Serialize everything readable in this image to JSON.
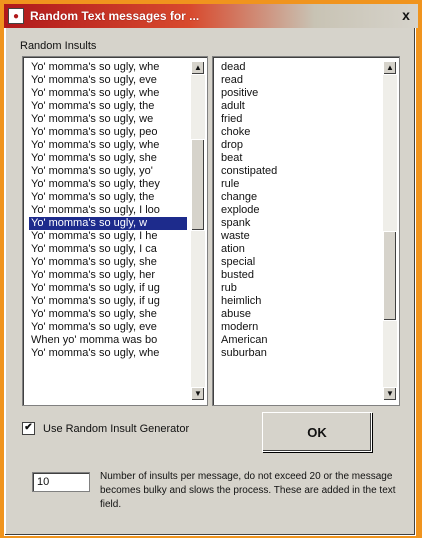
{
  "window": {
    "title": "Random Text messages for ...",
    "close_glyph": "x"
  },
  "group": {
    "label": "Random Insults"
  },
  "left_list": {
    "items": [
      "Yo' momma's so ugly, whe",
      "Yo' momma's so ugly, eve",
      "Yo' momma's so ugly, whe",
      "Yo' momma's so ugly, the",
      "Yo' momma's so ugly, we",
      "Yo' momma's so ugly, peo",
      "Yo' momma's so ugly, whe",
      "Yo' momma's so ugly, she",
      "Yo' momma's so ugly, yo'",
      "Yo' momma's so ugly, they",
      "Yo' momma's so ugly, the",
      "Yo' momma's so ugly, I loo",
      "Yo' momma's so ugly, w",
      "Yo' momma's so ugly, I he",
      "Yo' momma's so ugly, I ca",
      "Yo' momma's so ugly, she",
      "Yo' momma's so ugly, her",
      "Yo' momma's so ugly, if ug",
      "Yo' momma's so ugly, if ug",
      "Yo' momma's so ugly, she",
      "Yo' momma's so ugly, eve",
      "When yo' momma was bo",
      "Yo' momma's so ugly, whe"
    ],
    "selected_index": 12
  },
  "right_list": {
    "items": [
      "dead",
      "read",
      "positive",
      "adult",
      "fried",
      "choke",
      "drop",
      "beat",
      "constipated",
      "rule",
      "change",
      "explode",
      "spank",
      "waste",
      "ation",
      "special",
      "busted",
      "rub",
      "heimlich",
      "abuse",
      "modern",
      "American",
      "suburban"
    ]
  },
  "checkbox": {
    "label": "Use Random Insult Generator",
    "checked": true,
    "mark": "✔"
  },
  "ok_button": {
    "label": "OK"
  },
  "count": {
    "value": "10",
    "help": "Number of insults per message, do not exceed 20 or the message becomes bulky and slows the process. These are added in the text field."
  }
}
